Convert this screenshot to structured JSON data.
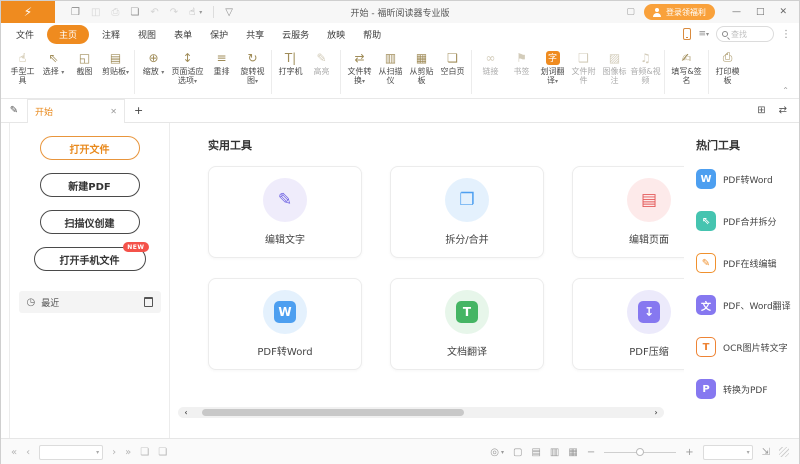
{
  "glyphs": {
    "dropdown": "▾"
  },
  "titlebar": {
    "logo_glyph": "⚡",
    "title": "开始 - 福昕阅读器专业版",
    "quick": [
      {
        "name": "open-file",
        "glyph": "❒"
      },
      {
        "name": "save",
        "glyph": "◫"
      },
      {
        "name": "print",
        "glyph": "⎙"
      },
      {
        "name": "new-document",
        "glyph": "❏"
      },
      {
        "name": "undo",
        "glyph": "↶"
      },
      {
        "name": "redo",
        "glyph": "↷"
      },
      {
        "name": "hand-tool",
        "glyph": "☝"
      },
      {
        "name": "customize-toolbar",
        "glyph": "▽"
      }
    ],
    "theme_glyph": "▢",
    "login_label": "登录领福利",
    "minimize_glyph": "—",
    "maximize_glyph": "□",
    "close_glyph": "✕"
  },
  "menubar": {
    "items": [
      {
        "label": "文件"
      },
      {
        "label": "主页"
      },
      {
        "label": "注释"
      },
      {
        "label": "视图"
      },
      {
        "label": "表单"
      },
      {
        "label": "保护"
      },
      {
        "label": "共享"
      },
      {
        "label": "云服务"
      },
      {
        "label": "放映"
      },
      {
        "label": "帮助"
      }
    ],
    "search_list_glyph": "≡",
    "search_placeholder": "查找",
    "more_glyph": "⋮"
  },
  "ribbon": {
    "groups": [
      {
        "items": [
          {
            "label": "手型工具",
            "glyph": "☝"
          },
          {
            "label": "选择",
            "glyph": "⇖"
          },
          {
            "label": "截图",
            "glyph": "◱"
          },
          {
            "label": "剪贴板",
            "glyph": "▤"
          }
        ]
      },
      {
        "items": [
          {
            "label": "缩放",
            "glyph": "⊕"
          },
          {
            "label": "页面适应选项",
            "glyph": "↕"
          },
          {
            "label": "重排",
            "glyph": "≡"
          },
          {
            "label": "旋转视图",
            "glyph": "↻"
          }
        ]
      },
      {
        "items": [
          {
            "label": "打字机",
            "glyph": "T|"
          },
          {
            "label": "高亮",
            "glyph": "✎"
          }
        ]
      },
      {
        "items": [
          {
            "label": "文件转换",
            "glyph": "⇄"
          },
          {
            "label": "从扫描仪",
            "glyph": "▥"
          },
          {
            "label": "从剪贴板",
            "glyph": "▦"
          },
          {
            "label": "空白页",
            "glyph": "❏"
          }
        ]
      },
      {
        "items": [
          {
            "label": "链接",
            "glyph": "∞"
          },
          {
            "label": "书签",
            "glyph": "⚑"
          },
          {
            "label": "划词翻译",
            "glyph": "字"
          },
          {
            "label": "文件附件",
            "glyph": "❑"
          },
          {
            "label": "图像标注",
            "glyph": "▨"
          },
          {
            "label": "音频&视频",
            "glyph": "♫"
          }
        ]
      },
      {
        "items": [
          {
            "label": "填写&签名",
            "glyph": "✍"
          }
        ]
      },
      {
        "items": [
          {
            "label": "打印模板",
            "glyph": "⎙"
          }
        ]
      }
    ],
    "collapse_glyph": "⌃"
  },
  "tabbar": {
    "edit_glyph": "✎",
    "tab_label": "开始",
    "close_glyph": "✕",
    "new_tab_glyph": "+",
    "grid_glyph": "⊞",
    "switch_glyph": "⇄"
  },
  "sidebar": {
    "buttons": [
      {
        "label": "打开文件"
      },
      {
        "label": "新建PDF"
      },
      {
        "label": "扫描仪创建"
      },
      {
        "label": "打开手机文件",
        "badge": "NEW"
      }
    ],
    "clock_glyph": "◷",
    "recent_label": "最近"
  },
  "main": {
    "heading": "实用工具",
    "cards": [
      {
        "label": "编辑文字",
        "circle_bg": "#efecfb",
        "glyph": "✎",
        "fg": "#7165e3",
        "box_bg": "transparent"
      },
      {
        "label": "拆分/合并",
        "circle_bg": "#e4f1fd",
        "glyph": "❐",
        "fg": "#4d9ff0",
        "box_bg": "transparent"
      },
      {
        "label": "编辑页面",
        "circle_bg": "#fdeaea",
        "glyph": "▤",
        "fg": "#e45b5b",
        "box_bg": "transparent"
      },
      {
        "label": "PDF转Word",
        "circle_bg": "#e4f1fd",
        "glyph": "W",
        "fg": "#ffffff",
        "box_bg": "#4d9ff0"
      },
      {
        "label": "文档翻译",
        "circle_bg": "#e7f6ea",
        "glyph": "T",
        "fg": "#ffffff",
        "box_bg": "#45b564"
      },
      {
        "label": "PDF压缩",
        "circle_bg": "#eceafb",
        "glyph": "↧",
        "fg": "#ffffff",
        "box_bg": "#8678f0"
      }
    ],
    "scroll_left_glyph": "‹",
    "scroll_right_glyph": "›"
  },
  "hot_tools": {
    "heading": "热门工具",
    "items": [
      {
        "label": "PDF转Word",
        "glyph": "W",
        "bg": "#4d9ff0",
        "fg": "#ffffff",
        "border": "#4d9ff0"
      },
      {
        "label": "PDF合并拆分",
        "glyph": "⇖",
        "bg": "#45c4b0",
        "fg": "#ffffff",
        "border": "#45c4b0"
      },
      {
        "label": "PDF在线编辑",
        "glyph": "✎",
        "bg": "#ffffff",
        "fg": "#f0912e",
        "border": "#f0912e"
      },
      {
        "label": "PDF、Word翻译",
        "glyph": "文",
        "bg": "#8678f0",
        "fg": "#ffffff",
        "border": "#8678f0"
      },
      {
        "label": "OCR图片转文字",
        "glyph": "T",
        "bg": "#ffffff",
        "fg": "#ee8435",
        "border": "#ee8435"
      },
      {
        "label": "转换为PDF",
        "glyph": "P",
        "bg": "#8678f0",
        "fg": "#ffffff",
        "border": "#8678f0"
      }
    ]
  },
  "statusbar": {
    "first_page_glyph": "«",
    "prev_page_glyph": "‹",
    "page_value": "",
    "next_page_glyph": "›",
    "last_page_glyph": "»",
    "prev_view_glyph": "❏",
    "next_view_glyph": "❏",
    "eye_glyph": "◎",
    "view_modes": [
      {
        "name": "single-page",
        "glyph": "▢"
      },
      {
        "name": "continuous",
        "glyph": "▤"
      },
      {
        "name": "facing",
        "glyph": "▥"
      },
      {
        "name": "facing-continuous",
        "glyph": "▦"
      }
    ],
    "zoom_out_glyph": "−",
    "zoom_in_glyph": "+",
    "zoom_value": "",
    "fullscreen_glyph": "⇲"
  }
}
